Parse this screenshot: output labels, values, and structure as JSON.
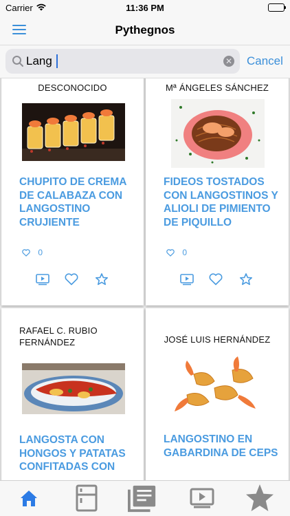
{
  "status": {
    "carrier": "Carrier",
    "time": "11:36 PM"
  },
  "nav": {
    "title": "Pythegnos",
    "menu_icon": "hamburger-menu-icon"
  },
  "search": {
    "value": "Lang",
    "cancel_label": "Cancel"
  },
  "colors": {
    "accent": "#4a9be0",
    "tab_active": "#2c7be5",
    "tab_inactive": "#8a8a8a"
  },
  "recipes": [
    {
      "author": "DESCONOCIDO",
      "title": "CHUPITO DE CREMA DE CALABAZA CON LANGOSTINO CRUJIENTE",
      "likes": "0"
    },
    {
      "author": "Mª ÁNGELES SÁNCHEZ",
      "title": "FIDEOS TOSTADOS CON LANGOSTINOS Y ALIOLI DE PIMIENTO DE PIQUILLO",
      "likes": "0"
    },
    {
      "author": "RAFAEL C. RUBIO FERNÁNDEZ",
      "title": "LANGOSTA CON HONGOS Y PATATAS CONFITADAS CON"
    },
    {
      "author": "JOSÉ LUIS HERNÁNDEZ",
      "title": "LANGOSTINO EN GABARDINA DE CEPS"
    }
  ],
  "tabs": [
    {
      "icon": "home-icon",
      "active": true
    },
    {
      "icon": "fridge-icon",
      "active": false
    },
    {
      "icon": "recipe-list-icon",
      "active": false
    },
    {
      "icon": "video-icon",
      "active": false
    },
    {
      "icon": "star-icon",
      "active": false
    }
  ]
}
